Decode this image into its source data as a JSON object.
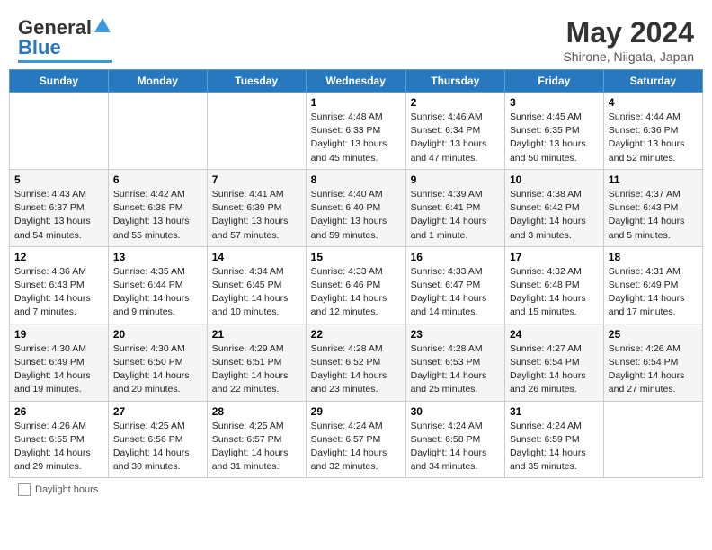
{
  "header": {
    "logo_text_general": "General",
    "logo_text_blue": "Blue",
    "month": "May 2024",
    "location": "Shirone, Niigata, Japan"
  },
  "days_of_week": [
    "Sunday",
    "Monday",
    "Tuesday",
    "Wednesday",
    "Thursday",
    "Friday",
    "Saturday"
  ],
  "weeks": [
    [
      {
        "day": "",
        "info": ""
      },
      {
        "day": "",
        "info": ""
      },
      {
        "day": "",
        "info": ""
      },
      {
        "day": "1",
        "info": "Sunrise: 4:48 AM\nSunset: 6:33 PM\nDaylight: 13 hours\nand 45 minutes."
      },
      {
        "day": "2",
        "info": "Sunrise: 4:46 AM\nSunset: 6:34 PM\nDaylight: 13 hours\nand 47 minutes."
      },
      {
        "day": "3",
        "info": "Sunrise: 4:45 AM\nSunset: 6:35 PM\nDaylight: 13 hours\nand 50 minutes."
      },
      {
        "day": "4",
        "info": "Sunrise: 4:44 AM\nSunset: 6:36 PM\nDaylight: 13 hours\nand 52 minutes."
      }
    ],
    [
      {
        "day": "5",
        "info": "Sunrise: 4:43 AM\nSunset: 6:37 PM\nDaylight: 13 hours\nand 54 minutes."
      },
      {
        "day": "6",
        "info": "Sunrise: 4:42 AM\nSunset: 6:38 PM\nDaylight: 13 hours\nand 55 minutes."
      },
      {
        "day": "7",
        "info": "Sunrise: 4:41 AM\nSunset: 6:39 PM\nDaylight: 13 hours\nand 57 minutes."
      },
      {
        "day": "8",
        "info": "Sunrise: 4:40 AM\nSunset: 6:40 PM\nDaylight: 13 hours\nand 59 minutes."
      },
      {
        "day": "9",
        "info": "Sunrise: 4:39 AM\nSunset: 6:41 PM\nDaylight: 14 hours\nand 1 minute."
      },
      {
        "day": "10",
        "info": "Sunrise: 4:38 AM\nSunset: 6:42 PM\nDaylight: 14 hours\nand 3 minutes."
      },
      {
        "day": "11",
        "info": "Sunrise: 4:37 AM\nSunset: 6:43 PM\nDaylight: 14 hours\nand 5 minutes."
      }
    ],
    [
      {
        "day": "12",
        "info": "Sunrise: 4:36 AM\nSunset: 6:43 PM\nDaylight: 14 hours\nand 7 minutes."
      },
      {
        "day": "13",
        "info": "Sunrise: 4:35 AM\nSunset: 6:44 PM\nDaylight: 14 hours\nand 9 minutes."
      },
      {
        "day": "14",
        "info": "Sunrise: 4:34 AM\nSunset: 6:45 PM\nDaylight: 14 hours\nand 10 minutes."
      },
      {
        "day": "15",
        "info": "Sunrise: 4:33 AM\nSunset: 6:46 PM\nDaylight: 14 hours\nand 12 minutes."
      },
      {
        "day": "16",
        "info": "Sunrise: 4:33 AM\nSunset: 6:47 PM\nDaylight: 14 hours\nand 14 minutes."
      },
      {
        "day": "17",
        "info": "Sunrise: 4:32 AM\nSunset: 6:48 PM\nDaylight: 14 hours\nand 15 minutes."
      },
      {
        "day": "18",
        "info": "Sunrise: 4:31 AM\nSunset: 6:49 PM\nDaylight: 14 hours\nand 17 minutes."
      }
    ],
    [
      {
        "day": "19",
        "info": "Sunrise: 4:30 AM\nSunset: 6:49 PM\nDaylight: 14 hours\nand 19 minutes."
      },
      {
        "day": "20",
        "info": "Sunrise: 4:30 AM\nSunset: 6:50 PM\nDaylight: 14 hours\nand 20 minutes."
      },
      {
        "day": "21",
        "info": "Sunrise: 4:29 AM\nSunset: 6:51 PM\nDaylight: 14 hours\nand 22 minutes."
      },
      {
        "day": "22",
        "info": "Sunrise: 4:28 AM\nSunset: 6:52 PM\nDaylight: 14 hours\nand 23 minutes."
      },
      {
        "day": "23",
        "info": "Sunrise: 4:28 AM\nSunset: 6:53 PM\nDaylight: 14 hours\nand 25 minutes."
      },
      {
        "day": "24",
        "info": "Sunrise: 4:27 AM\nSunset: 6:54 PM\nDaylight: 14 hours\nand 26 minutes."
      },
      {
        "day": "25",
        "info": "Sunrise: 4:26 AM\nSunset: 6:54 PM\nDaylight: 14 hours\nand 27 minutes."
      }
    ],
    [
      {
        "day": "26",
        "info": "Sunrise: 4:26 AM\nSunset: 6:55 PM\nDaylight: 14 hours\nand 29 minutes."
      },
      {
        "day": "27",
        "info": "Sunrise: 4:25 AM\nSunset: 6:56 PM\nDaylight: 14 hours\nand 30 minutes."
      },
      {
        "day": "28",
        "info": "Sunrise: 4:25 AM\nSunset: 6:57 PM\nDaylight: 14 hours\nand 31 minutes."
      },
      {
        "day": "29",
        "info": "Sunrise: 4:24 AM\nSunset: 6:57 PM\nDaylight: 14 hours\nand 32 minutes."
      },
      {
        "day": "30",
        "info": "Sunrise: 4:24 AM\nSunset: 6:58 PM\nDaylight: 14 hours\nand 34 minutes."
      },
      {
        "day": "31",
        "info": "Sunrise: 4:24 AM\nSunset: 6:59 PM\nDaylight: 14 hours\nand 35 minutes."
      },
      {
        "day": "",
        "info": ""
      }
    ]
  ],
  "footer": {
    "daylight_label": "Daylight hours"
  }
}
